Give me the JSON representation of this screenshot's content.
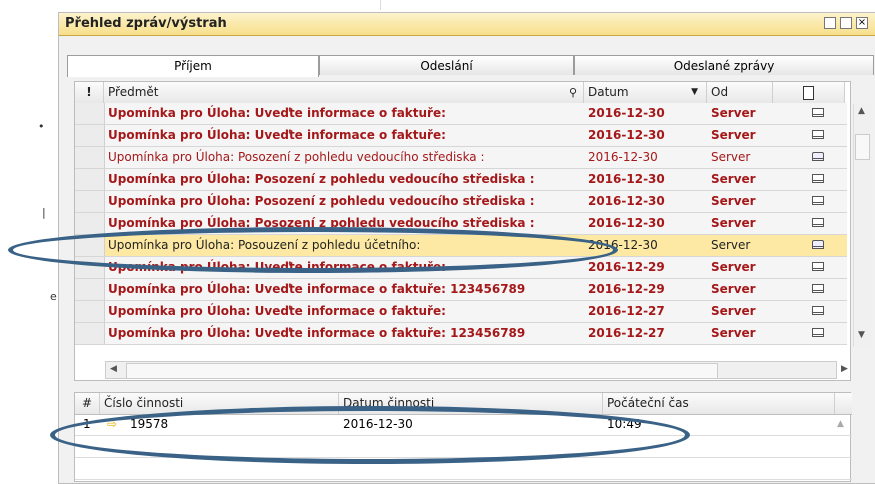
{
  "window": {
    "title": "Přehled zpráv/výstrah"
  },
  "tabs": [
    {
      "label": "Příjem",
      "active": true
    },
    {
      "label": "Odeslání",
      "active": false
    },
    {
      "label": "Odeslané zprávy",
      "active": false
    }
  ],
  "messages": {
    "columns": {
      "flag": "!",
      "subject": "Předmět",
      "date": "Datum",
      "from": "Od"
    },
    "rows": [
      {
        "subject": "Upomínka pro Úloha: Uveďte informace o faktuře:",
        "date": "2016-12-30",
        "from": "Server",
        "unread": true
      },
      {
        "subject": "Upomínka pro Úloha: Uveďte informace o faktuře:",
        "date": "2016-12-30",
        "from": "Server",
        "unread": true
      },
      {
        "subject": "Upomínka pro Úloha: Posození z pohledu vedoucího střediska :",
        "date": "2016-12-30",
        "from": "Server",
        "unread": false
      },
      {
        "subject": "Upomínka pro Úloha: Posození z pohledu vedoucího střediska :",
        "date": "2016-12-30",
        "from": "Server",
        "unread": true
      },
      {
        "subject": "Upomínka pro Úloha: Posození z pohledu vedoucího střediska :",
        "date": "2016-12-30",
        "from": "Server",
        "unread": true
      },
      {
        "subject": "Upomínka pro Úloha: Posození z pohledu vedoucího střediska :",
        "date": "2016-12-30",
        "from": "Server",
        "unread": true
      },
      {
        "subject": "Upomínka pro Úloha: Posouzení z pohledu účetního:",
        "date": "2016-12-30",
        "from": "Server",
        "unread": false,
        "selected": true
      },
      {
        "subject": "Upomínka pro Úloha: Uveďte informace o faktuře:",
        "date": "2016-12-29",
        "from": "Server",
        "unread": true
      },
      {
        "subject": "Upomínka pro Úloha: Uveďte informace o faktuře: 123456789",
        "date": "2016-12-29",
        "from": "Server",
        "unread": true
      },
      {
        "subject": "Upomínka pro Úloha: Uveďte informace o faktuře:",
        "date": "2016-12-27",
        "from": "Server",
        "unread": true
      },
      {
        "subject": "Upomínka pro Úloha: Uveďte informace o faktuře: 123456789",
        "date": "2016-12-27",
        "from": "Server",
        "unread": true
      }
    ]
  },
  "activities": {
    "columns": {
      "num": "#",
      "activity_no": "Číslo činnosti",
      "activity_date": "Datum činnosti",
      "start_time": "Počáteční čas"
    },
    "rows": [
      {
        "num": "1",
        "activity_no": "19578",
        "activity_date": "2016-12-30",
        "start_time": "10:49"
      }
    ]
  },
  "colors": {
    "unread_text": "#a5181a",
    "selected_row": "#fde9a3",
    "annotation": "#3a6286"
  }
}
